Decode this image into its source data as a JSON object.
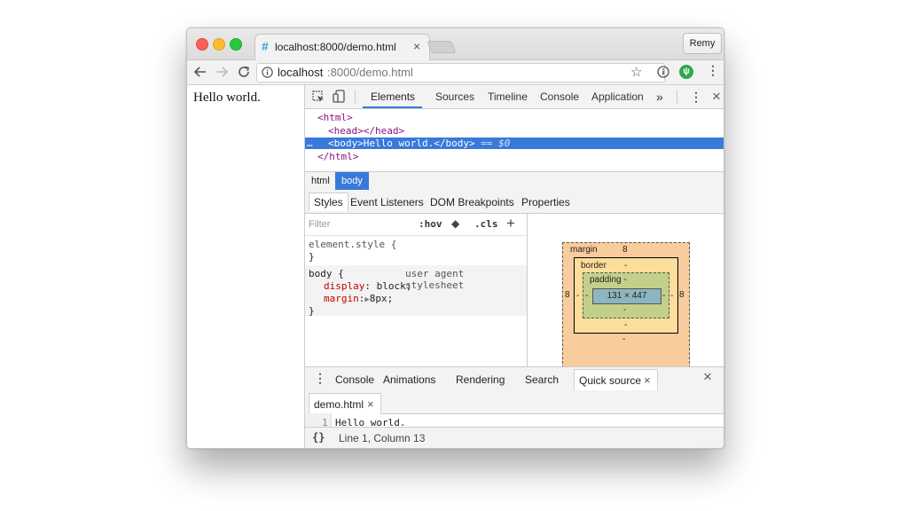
{
  "browser": {
    "tab_title": "localhost:8000/demo.html",
    "tab_close": "×",
    "profile_name": "Remy",
    "url_host": "localhost",
    "url_rest": ":8000/demo.html"
  },
  "page": {
    "text": "Hello world."
  },
  "devtools": {
    "tabs": [
      "Elements",
      "Sources",
      "Timeline",
      "Console",
      "Application"
    ],
    "more_tabs": "»",
    "close": "×",
    "dom": {
      "line1": "<html>",
      "line2_open": "<head>",
      "line2_close": "</head>",
      "line3_dots": "…",
      "line3_open": "<body>",
      "line3_text": "Hello world.",
      "line3_close": "</body>",
      "line3_suffix": "== $0",
      "line4": "</html>"
    },
    "breadcrumbs": [
      "html",
      "body"
    ],
    "subtabs": [
      "Styles",
      "Event Listeners",
      "DOM Breakpoints",
      "Properties"
    ],
    "styles": {
      "filter_placeholder": "Filter",
      "hov": ":hov",
      "cls": ".cls",
      "add": "+",
      "element_style": "element.style {",
      "close_brace": "}",
      "body_selector": "body {",
      "source": "user agent stylesheet",
      "prop1_name": "display",
      "prop1_value": "block;",
      "prop2_name": "margin",
      "prop2_value": "8px;"
    },
    "box_model": {
      "margin_label": "margin",
      "margin_value": "8",
      "border_label": "border",
      "border_value": "-",
      "padding_label": "padding -",
      "content": "131 × 447",
      "left_margin": "8",
      "right_margin": "8",
      "dash": "-"
    },
    "drawer": {
      "tabs": [
        "Console",
        "Animations",
        "Rendering",
        "Search",
        "Quick source"
      ],
      "tab_close": "×",
      "close": "×",
      "file_tab": "demo.html",
      "line_number": "1",
      "code": "Hello world."
    },
    "status": {
      "pretty_print": "{}",
      "position": "Line 1, Column 13"
    }
  }
}
